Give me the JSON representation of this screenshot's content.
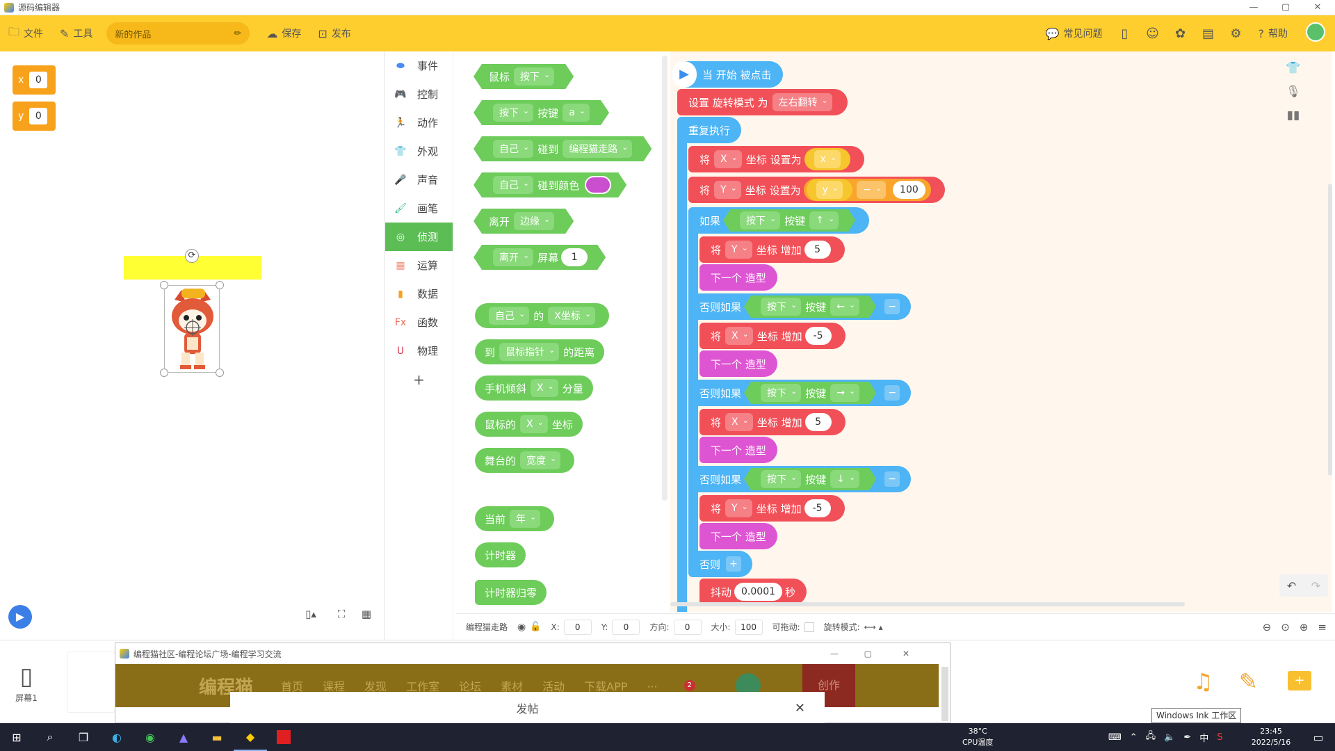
{
  "window": {
    "title": "源码编辑器",
    "min": "—",
    "max": "▢",
    "close": "✕"
  },
  "toolbar": {
    "file": "文件",
    "tools": "工具",
    "project_name": "新的作品",
    "save": "保存",
    "publish": "发布",
    "faq": "常见问题",
    "help": "帮助",
    "accent": "#fece2f"
  },
  "stage": {
    "var_x_label": "x",
    "var_x_value": "0",
    "var_y_label": "y",
    "var_y_value": "0"
  },
  "categories": [
    "事件",
    "控制",
    "动作",
    "外观",
    "声音",
    "画笔",
    "侦测",
    "运算",
    "数据",
    "函数",
    "物理"
  ],
  "category_selected": "侦测",
  "category_colors": [
    "#4b8bf5",
    "#4fb4f0",
    "#e35a5a",
    "#d85ad6",
    "#9e6bea",
    "#2fb18a",
    "#5cbd55",
    "#f38e7c",
    "#f7a21a",
    "#f56b5a",
    "#d8374a"
  ],
  "palette": {
    "b1": {
      "t1": "鼠标",
      "d1": "按下"
    },
    "b2": {
      "d1": "按下",
      "t1": "按键",
      "d2": "a"
    },
    "b3": {
      "d1": "自己",
      "t1": "碰到",
      "d2": "编程猫走路"
    },
    "b4": {
      "d1": "自己",
      "t1": "碰到颜色",
      "color": "#c94fcf"
    },
    "b5": {
      "t1": "离开",
      "d1": "边缘"
    },
    "b6": {
      "d1": "离开",
      "t1": "屏幕",
      "v1": "1"
    },
    "b7": {
      "d1": "自己",
      "t1": "的",
      "d2": "X坐标"
    },
    "b8": {
      "t1": "到",
      "d1": "鼠标指针",
      "t2": "的距离"
    },
    "b9": {
      "t1": "手机倾斜",
      "d1": "X",
      "t2": "分量"
    },
    "b10": {
      "t1": "鼠标的",
      "d1": "X",
      "t2": "坐标"
    },
    "b11": {
      "t1": "舞台的",
      "d1": "宽度"
    },
    "b12": {
      "t1": "当前",
      "d1": "年"
    },
    "b13": {
      "t1": "计时器"
    },
    "b14": {
      "t1": "计时器归零"
    }
  },
  "script": {
    "hat": "当 开始 被点击",
    "s1": {
      "t1": "设置 旋转模式 为",
      "d1": "左右翻转"
    },
    "loop": "重复执行",
    "s2": {
      "t1": "将",
      "d1": "X",
      "t2": "坐标 设置为",
      "d2": "x"
    },
    "s3": {
      "t1": "将",
      "d1": "Y",
      "t2": "坐标 设置为",
      "d2": "y",
      "op": "−",
      "v": "100"
    },
    "if1": {
      "t1": "如果",
      "d1": "按下",
      "t2": "按键",
      "d2": "↑"
    },
    "a1": {
      "t1": "将",
      "d1": "Y",
      "t2": "坐标 增加",
      "v": "5"
    },
    "n1": "下一个 造型",
    "if2": {
      "t1": "否则如果",
      "d1": "按下",
      "t2": "按键",
      "d2": "←",
      "btn": "−"
    },
    "a2": {
      "t1": "将",
      "d1": "X",
      "t2": "坐标 增加",
      "v": "-5"
    },
    "n2": "下一个 造型",
    "if3": {
      "t1": "否则如果",
      "d1": "按下",
      "t2": "按键",
      "d2": "→",
      "btn": "−"
    },
    "a3": {
      "t1": "将",
      "d1": "X",
      "t2": "坐标 增加",
      "v": "5"
    },
    "n3": "下一个 造型",
    "if4": {
      "t1": "否则如果",
      "d1": "按下",
      "t2": "按键",
      "d2": "↓",
      "btn": "−"
    },
    "a4": {
      "t1": "将",
      "d1": "Y",
      "t2": "坐标 增加",
      "v": "-5"
    },
    "n4": "下一个 造型",
    "else": {
      "t1": "否则",
      "btn": "+"
    },
    "shake": {
      "t1": "抖动",
      "v": "0.0001",
      "t2": "秒"
    }
  },
  "props": {
    "sprite": "编程猫走路",
    "x_label": "X:",
    "x": "0",
    "y_label": "Y:",
    "y": "0",
    "dir_label": "方向:",
    "dir": "0",
    "size_label": "大小:",
    "size": "100",
    "drag_label": "可拖动:",
    "rot_label": "旋转模式:",
    "rot": "⟷ ▴"
  },
  "assets": {
    "screen_label": "屏幕1"
  },
  "browser": {
    "title": "编程猫社区-编程论坛广场-编程学习交流",
    "logo": "编程猫",
    "nav": [
      "首页",
      "课程",
      "发现",
      "工作室",
      "论坛",
      "素材",
      "活动",
      "下载APP",
      "···"
    ],
    "badge": "2",
    "create": "创作",
    "post": "发帖",
    "close": "✕"
  },
  "tooltip": "Windows Ink 工作区",
  "taskbar": {
    "temp": "38°C",
    "temp_label": "CPU温度",
    "ime": "中",
    "time": "23:45",
    "date": "2022/5/16"
  }
}
